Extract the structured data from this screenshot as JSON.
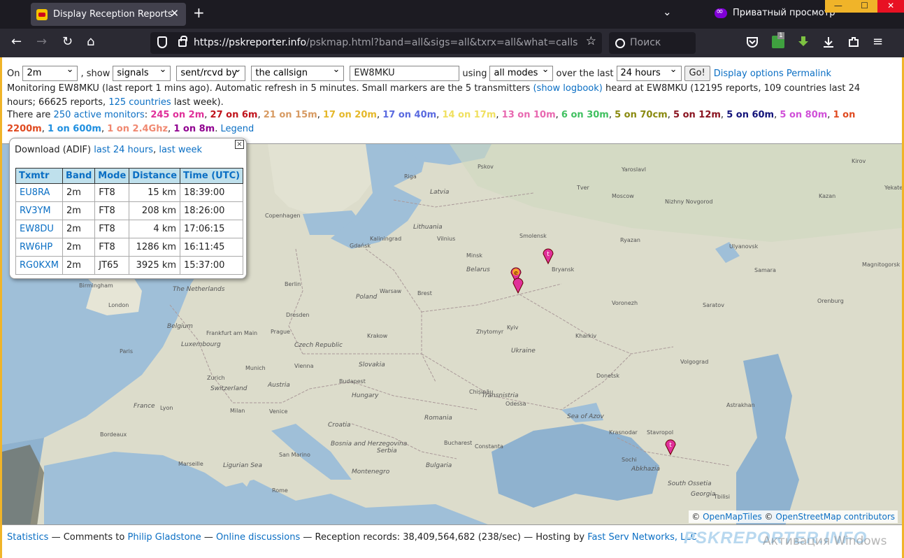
{
  "browser": {
    "tab_title": "Display Reception Reports",
    "private_label": "Приватный просмотр",
    "url_host": "https://pskreporter.info",
    "url_path": "/pskmap.html?band=all&sigs=all&txrx=all&what=callsign&callsign",
    "search_placeholder": "Поиск",
    "ext_badge": "1"
  },
  "controls": {
    "on_label": "On",
    "band": "2m",
    "show_label": ", show",
    "sigs": "signals",
    "txrx": "sent/rcvd by",
    "what": "the callsign",
    "callsign": "EW8MKU",
    "using_label": "using",
    "mode": "all modes",
    "over_label": "over the last",
    "period": "24 hours",
    "go": "Go!",
    "display_options": "Display options",
    "permalink": "Permalink"
  },
  "status": {
    "monitoring": "Monitoring EW8MKU (last report 1 mins ago). Automatic refresh in 5 minutes. Small markers are the 5 transmitters",
    "show_logbook": "(show logbook)",
    "heard": "heard at EW8MKU (12195 reports, 109 countries last 24 hours; 66625 reports,",
    "countries_link": "125 countries",
    "last_week": "last week)."
  },
  "monitors": {
    "prefix": "There are",
    "active_link": "250 active monitors",
    "colon": ":",
    "bands": [
      {
        "text": "245 on 2m",
        "color": "#e0309a"
      },
      {
        "text": "27 on 6m",
        "color": "#c0141c"
      },
      {
        "text": "21 on 15m",
        "color": "#d79a62"
      },
      {
        "text": "17 on 20m",
        "color": "#e5b82a"
      },
      {
        "text": "17 on 40m",
        "color": "#5a6ae0"
      },
      {
        "text": "14 on 17m",
        "color": "#f0e060"
      },
      {
        "text": "13 on 10m",
        "color": "#e868b0"
      },
      {
        "text": "6 on 30m",
        "color": "#40c060"
      },
      {
        "text": "5 on 70cm",
        "color": "#8a8a10"
      },
      {
        "text": "5 on 12m",
        "color": "#8a1420"
      },
      {
        "text": "5 on 60m",
        "color": "#14147a"
      },
      {
        "text": "5 on 80m",
        "color": "#d050d8"
      },
      {
        "text": "1 on 2200m",
        "color": "#e04a20"
      },
      {
        "text": "1 on 600m",
        "color": "#2090e0"
      },
      {
        "text": "1 on 2.4Ghz",
        "color": "#f08870"
      },
      {
        "text": "1 on 8m",
        "color": "#900090"
      }
    ],
    "legend": "Legend"
  },
  "popup": {
    "download_label": "Download (ADIF)",
    "link_24h": "last 24 hours",
    "link_week": "last week",
    "close": "×",
    "headers": [
      "Txmtr",
      "Band",
      "Mode",
      "Distance",
      "Time (UTC)"
    ],
    "rows": [
      {
        "txmtr": "EU8RA",
        "band": "2m",
        "mode": "FT8",
        "distance": "15 km",
        "time": "18:39:00"
      },
      {
        "txmtr": "RV3YM",
        "band": "2m",
        "mode": "FT8",
        "distance": "208 km",
        "time": "18:26:00"
      },
      {
        "txmtr": "EW8DU",
        "band": "2m",
        "mode": "FT8",
        "distance": "4 km",
        "time": "17:06:15"
      },
      {
        "txmtr": "RW6HP",
        "band": "2m",
        "mode": "FT8",
        "distance": "1286 km",
        "time": "16:11:45"
      },
      {
        "txmtr": "RG0KXM",
        "band": "2m",
        "mode": "JT65",
        "distance": "3925 km",
        "time": "15:37:00"
      }
    ]
  },
  "map": {
    "attribution_sep": "©",
    "openmaptiles": "OpenMapTiles",
    "openstreetmap": "OpenStreetMap contributors",
    "places": [
      "Pskov",
      "Yaroslavl",
      "Kirov",
      "Tver",
      "Yekate",
      "Riga",
      "Latvia",
      "Moscow",
      "Nizhny Novgorod",
      "Kazan",
      "Copenhagen",
      "Lithuania",
      "Smolensk",
      "Ryazan",
      "Vilnius",
      "Gdańsk",
      "Kaliningrad",
      "Ulyanovsk",
      "Minsk",
      "Belarus",
      "Bryansk",
      "Samara",
      "Magnitogorsk",
      "Birmingham",
      "Berlin",
      "Warsaw",
      "Brest",
      "Voronezh",
      "Orenburg",
      "The Netherlands",
      "London",
      "Poland",
      "Saratov",
      "Belgium",
      "Dresden",
      "Frankfurt am Main",
      "Prague",
      "Kyiv",
      "Zhytomyr",
      "Kharkiv",
      "Luxembourg",
      "Czech Republic",
      "Krakow",
      "Ukraine",
      "Paris",
      "Munich",
      "Vienna",
      "Slovakia",
      "Volgograd",
      "Switzerland",
      "Zurich",
      "Budapest",
      "Hungary",
      "Donetsk",
      "France",
      "Chișinău",
      "Transnistria",
      "Odessa",
      "Astrakhan",
      "Austria",
      "Lyon",
      "Milan",
      "Venice",
      "Croatia",
      "Romania",
      "Sea of Azov",
      "Bordeaux",
      "Bosnia and Herzegovina",
      "Serbia",
      "Bucharest",
      "Krasnodar",
      "Stavropol",
      "Constanta",
      "Sochi",
      "Abkhazia",
      "Ligurian Sea",
      "Marseille",
      "San Marino",
      "Montenegro",
      "Bulgaria",
      "South Ossetia",
      "Georgia",
      "Rome",
      "Tbilisi"
    ]
  },
  "footer": {
    "statistics": "Statistics",
    "sep1": "— Comments to",
    "author": "Philip Gladstone",
    "sep2": "—",
    "discussions": "Online discussions",
    "records": "— Reception records: 38,409,564,682 (238/sec) — Hosting by",
    "hosting": "Fast Serv Networks, LLC"
  },
  "watermark": {
    "brand": "PSKREPORTER.INFO",
    "windows": "Активация Windows"
  }
}
